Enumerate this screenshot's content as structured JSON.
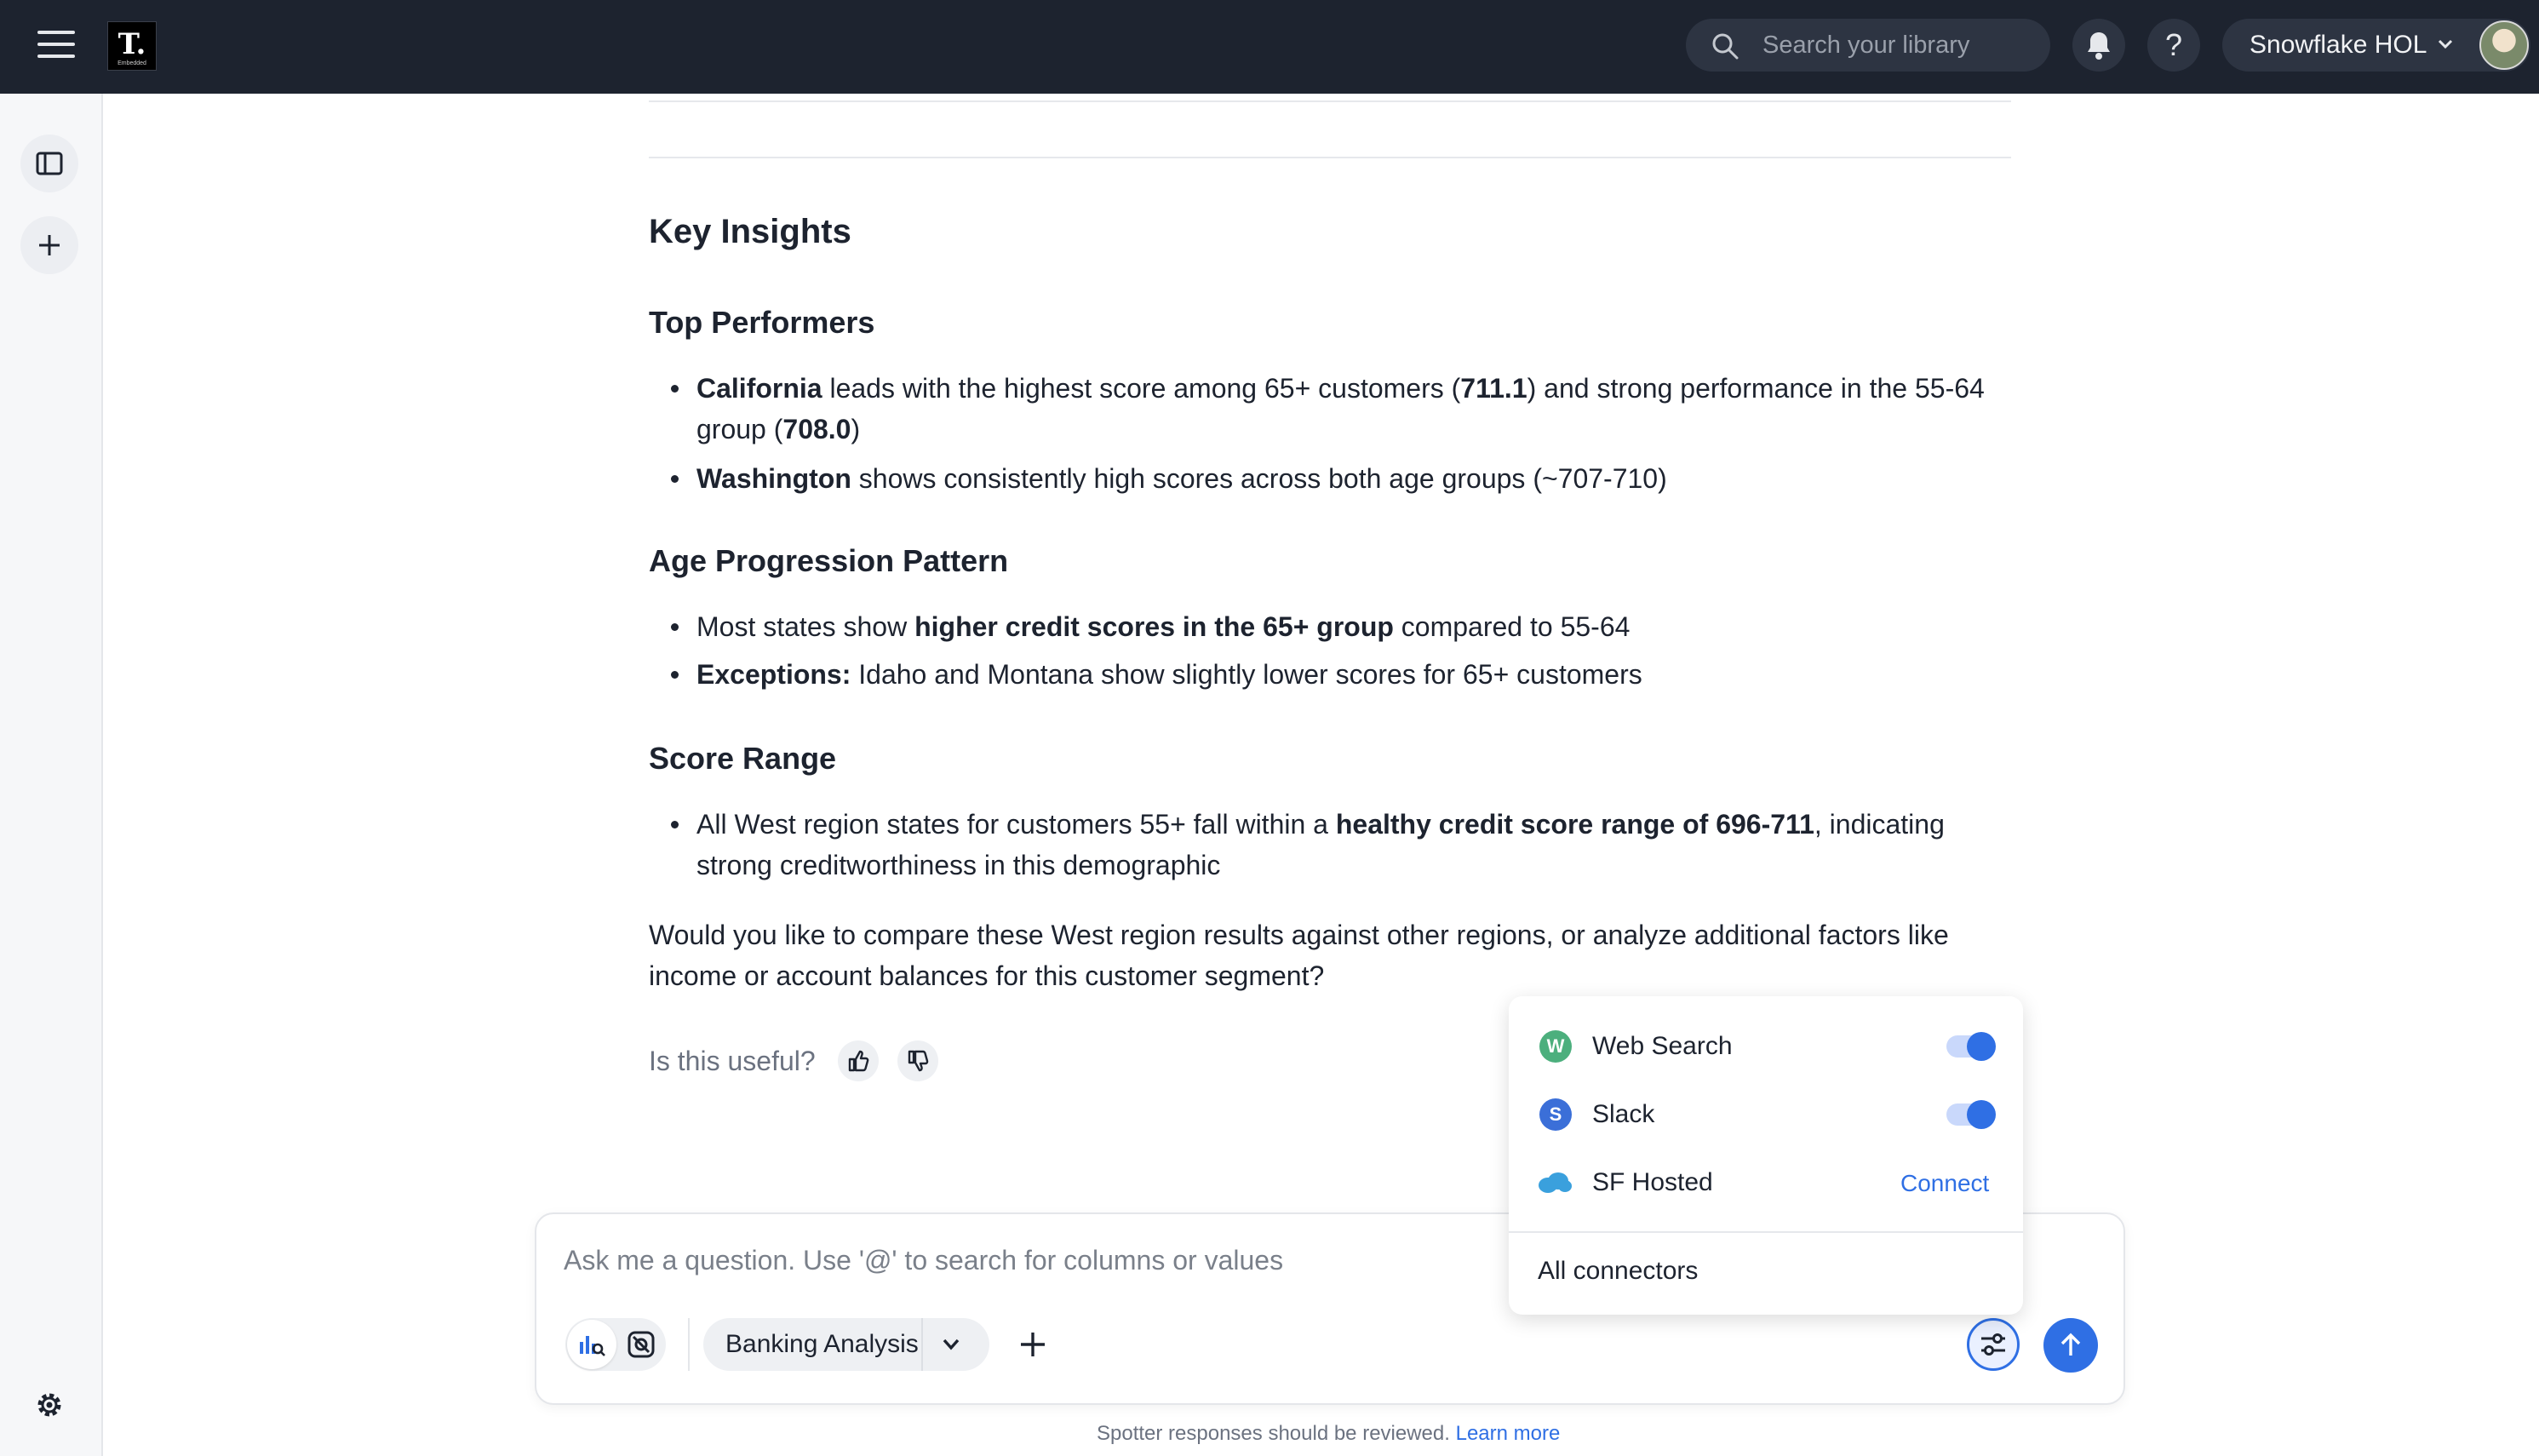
{
  "header": {
    "logo_letter": "T.",
    "logo_sub": "Embedded",
    "search_placeholder": "Search your library",
    "help_label": "?",
    "org_name": "Snowflake HOL"
  },
  "content": {
    "key_insights": "Key Insights",
    "sections": [
      {
        "title": "Top Performers",
        "bullets": [
          {
            "b1": "California",
            "t1": " leads with the highest score among 65+ customers (",
            "b2": "711.1",
            "t2": ") and strong performance in the 55-64 group (",
            "b3": "708.0",
            "t3": ")"
          },
          {
            "b1": "Washington",
            "t1": " shows consistently high scores across both age groups (~707-710)"
          }
        ]
      },
      {
        "title": "Age Progression Pattern",
        "bullets": [
          {
            "t0": "Most states show ",
            "b1": "higher credit scores in the 65+ group",
            "t1": " compared to 55-64"
          },
          {
            "b1": "Exceptions:",
            "t1": " Idaho and Montana show slightly lower scores for 65+ customers"
          }
        ]
      },
      {
        "title": "Score Range",
        "bullets": [
          {
            "t0": "All West region states for customers 55+ fall within a ",
            "b1": "healthy credit score range of 696-711",
            "t1": ", indicating strong creditworthiness in this demographic"
          }
        ]
      }
    ],
    "closing": "Would you like to compare these West region results against other regions, or analyze additional factors like income or account balances for this customer segment?",
    "feedback_prompt": "Is this useful?"
  },
  "connectors": {
    "items": [
      {
        "initial": "W",
        "label": "Web Search",
        "color": "#4caf7d",
        "enabled": true
      },
      {
        "initial": "S",
        "label": "Slack",
        "color": "#3b6fd8",
        "enabled": true
      },
      {
        "label": "SF Hosted",
        "action": "Connect"
      }
    ],
    "all_label": "All connectors"
  },
  "prompt": {
    "placeholder": "Ask me a question. Use '@' to search for columns or values",
    "datasource": "Banking Analysis"
  },
  "footer": {
    "notice": "Spotter responses should be reviewed.",
    "link": "Learn more"
  }
}
